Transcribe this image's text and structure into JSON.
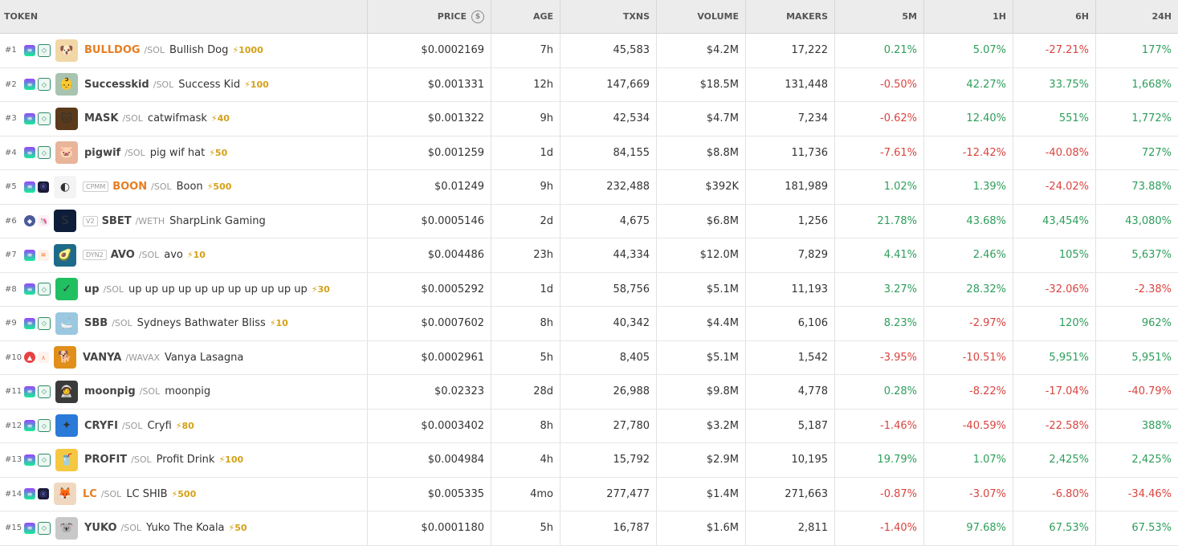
{
  "headers": {
    "token": "TOKEN",
    "price": "PRICE",
    "age": "AGE",
    "txns": "TXNS",
    "volume": "VOLUME",
    "makers": "MAKERS",
    "m5": "5M",
    "h1": "1H",
    "h6": "6H",
    "h24": "24H"
  },
  "rows": [
    {
      "rank": "#1",
      "chain": "sol",
      "dex": "raydium",
      "tag": "",
      "sym": "BULLDOG",
      "sym_color": "orange",
      "quote": "/SOL",
      "name": "Bullish Dog",
      "boost": "⚡1000",
      "avatar": "🐶",
      "avatar_bg": "#f2d7a6",
      "price": "$0.0002169",
      "age": "7h",
      "txns": "45,583",
      "volume": "$4.2M",
      "makers": "17,222",
      "m5": "0.21%",
      "h1": "5.07%",
      "h6": "-27.21%",
      "h24": "177%"
    },
    {
      "rank": "#2",
      "chain": "sol",
      "dex": "raydium",
      "tag": "",
      "sym": "Successkid",
      "sym_color": "",
      "quote": "/SOL",
      "name": "Success Kid",
      "boost": "⚡100",
      "avatar": "👶",
      "avatar_bg": "#a8c4b0",
      "price": "$0.001331",
      "age": "12h",
      "txns": "147,669",
      "volume": "$18.5M",
      "makers": "131,448",
      "m5": "-0.50%",
      "h1": "42.27%",
      "h6": "33.75%",
      "h24": "1,668%"
    },
    {
      "rank": "#3",
      "chain": "sol",
      "dex": "raydium",
      "tag": "",
      "sym": "MASK",
      "sym_color": "",
      "quote": "/SOL",
      "name": "catwifmask",
      "boost": "⚡40",
      "avatar": "🐱",
      "avatar_bg": "#5a3a1a",
      "price": "$0.001322",
      "age": "9h",
      "txns": "42,534",
      "volume": "$4.7M",
      "makers": "7,234",
      "m5": "-0.62%",
      "h1": "12.40%",
      "h6": "551%",
      "h24": "1,772%"
    },
    {
      "rank": "#4",
      "chain": "sol",
      "dex": "raydium",
      "tag": "",
      "sym": "pigwif",
      "sym_color": "",
      "quote": "/SOL",
      "name": "pig wif hat",
      "boost": "⚡50",
      "avatar": "🐷",
      "avatar_bg": "#e8b49a",
      "price": "$0.001259",
      "age": "1d",
      "txns": "84,155",
      "volume": "$8.8M",
      "makers": "11,736",
      "m5": "-7.61%",
      "h1": "-12.42%",
      "h6": "-40.08%",
      "h24": "727%"
    },
    {
      "rank": "#5",
      "chain": "sol",
      "dex": "meteora",
      "tag": "CPMM",
      "sym": "BOON",
      "sym_color": "orange",
      "quote": "/SOL",
      "name": "Boon",
      "boost": "⚡500",
      "avatar": "◐",
      "avatar_bg": "#f4f4f4",
      "price": "$0.01249",
      "age": "9h",
      "txns": "232,488",
      "volume": "$392K",
      "makers": "181,989",
      "m5": "1.02%",
      "h1": "1.39%",
      "h6": "-24.02%",
      "h24": "73.88%"
    },
    {
      "rank": "#6",
      "chain": "eth",
      "dex": "uni",
      "tag": "V2",
      "sym": "SBET",
      "sym_color": "",
      "quote": "/WETH",
      "name": "SharpLink Gaming",
      "boost": "",
      "avatar": "S",
      "avatar_bg": "#0e1e3a",
      "price": "$0.0005146",
      "age": "2d",
      "txns": "4,675",
      "volume": "$6.8M",
      "makers": "1,256",
      "m5": "21.78%",
      "h1": "43.68%",
      "h6": "43,454%",
      "h24": "43,080%"
    },
    {
      "rank": "#7",
      "chain": "sol",
      "dex": "orca",
      "tag": "DYN2",
      "sym": "AVO",
      "sym_color": "",
      "quote": "/SOL",
      "name": "avo",
      "boost": "⚡10",
      "avatar": "🥑",
      "avatar_bg": "#1e6a8a",
      "price": "$0.004486",
      "age": "23h",
      "txns": "44,334",
      "volume": "$12.0M",
      "makers": "7,829",
      "m5": "4.41%",
      "h1": "2.46%",
      "h6": "105%",
      "h24": "5,637%"
    },
    {
      "rank": "#8",
      "chain": "sol",
      "dex": "raydium",
      "tag": "",
      "sym": "up",
      "sym_color": "",
      "quote": "/SOL",
      "name": "up up up up up up up up up up up",
      "boost": "⚡30",
      "avatar": "✓",
      "avatar_bg": "#20c060",
      "price": "$0.0005292",
      "age": "1d",
      "txns": "58,756",
      "volume": "$5.1M",
      "makers": "11,193",
      "m5": "3.27%",
      "h1": "28.32%",
      "h6": "-32.06%",
      "h24": "-2.38%"
    },
    {
      "rank": "#9",
      "chain": "sol",
      "dex": "raydium",
      "tag": "",
      "sym": "SBB",
      "sym_color": "",
      "quote": "/SOL",
      "name": "Sydneys Bathwater Bliss",
      "boost": "⚡10",
      "avatar": "🛁",
      "avatar_bg": "#9ac8e0",
      "price": "$0.0007602",
      "age": "8h",
      "txns": "40,342",
      "volume": "$4.4M",
      "makers": "6,106",
      "m5": "8.23%",
      "h1": "-2.97%",
      "h6": "120%",
      "h24": "962%"
    },
    {
      "rank": "#10",
      "chain": "avax",
      "dex": "lfj",
      "tag": "",
      "sym": "VANYA",
      "sym_color": "",
      "quote": "/WAVAX",
      "name": "Vanya Lasagna",
      "boost": "",
      "avatar": "🐕",
      "avatar_bg": "#e0901a",
      "price": "$0.0002961",
      "age": "5h",
      "txns": "8,405",
      "volume": "$5.1M",
      "makers": "1,542",
      "m5": "-3.95%",
      "h1": "-10.51%",
      "h6": "5,951%",
      "h24": "5,951%"
    },
    {
      "rank": "#11",
      "chain": "sol",
      "dex": "raydium",
      "tag": "",
      "sym": "moonpig",
      "sym_color": "",
      "quote": "/SOL",
      "name": "moonpig",
      "boost": "",
      "avatar": "🧑‍🚀",
      "avatar_bg": "#3a3a3a",
      "price": "$0.02323",
      "age": "28d",
      "txns": "26,988",
      "volume": "$9.8M",
      "makers": "4,778",
      "m5": "0.28%",
      "h1": "-8.22%",
      "h6": "-17.04%",
      "h24": "-40.79%"
    },
    {
      "rank": "#12",
      "chain": "sol",
      "dex": "raydium",
      "tag": "",
      "sym": "CRYFI",
      "sym_color": "",
      "quote": "/SOL",
      "name": "Cryfi",
      "boost": "⚡80",
      "avatar": "✦",
      "avatar_bg": "#2a7ad8",
      "price": "$0.0003402",
      "age": "8h",
      "txns": "27,780",
      "volume": "$3.2M",
      "makers": "5,187",
      "m5": "-1.46%",
      "h1": "-40.59%",
      "h6": "-22.58%",
      "h24": "388%"
    },
    {
      "rank": "#13",
      "chain": "sol",
      "dex": "raydium",
      "tag": "",
      "sym": "PROFIT",
      "sym_color": "",
      "quote": "/SOL",
      "name": "Profit Drink",
      "boost": "⚡100",
      "avatar": "🥤",
      "avatar_bg": "#f5c842",
      "price": "$0.004984",
      "age": "4h",
      "txns": "15,792",
      "volume": "$2.9M",
      "makers": "10,195",
      "m5": "19.79%",
      "h1": "1.07%",
      "h6": "2,425%",
      "h24": "2,425%"
    },
    {
      "rank": "#14",
      "chain": "sol",
      "dex": "meteora",
      "tag": "",
      "sym": "LC",
      "sym_color": "orange",
      "quote": "/SOL",
      "name": "LC SHIB",
      "boost": "⚡500",
      "avatar": "🦊",
      "avatar_bg": "#f0d8c0",
      "price": "$0.005335",
      "age": "4mo",
      "txns": "277,477",
      "volume": "$1.4M",
      "makers": "271,663",
      "m5": "-0.87%",
      "h1": "-3.07%",
      "h6": "-6.80%",
      "h24": "-34.46%"
    },
    {
      "rank": "#15",
      "chain": "sol",
      "dex": "raydium",
      "tag": "",
      "sym": "YUKO",
      "sym_color": "",
      "quote": "/SOL",
      "name": "Yuko The Koala",
      "boost": "⚡50",
      "avatar": "🐨",
      "avatar_bg": "#c8c8c8",
      "price": "$0.0001180",
      "age": "5h",
      "txns": "16,787",
      "volume": "$1.6M",
      "makers": "2,811",
      "m5": "-1.40%",
      "h1": "97.68%",
      "h6": "67.53%",
      "h24": "67.53%"
    }
  ]
}
